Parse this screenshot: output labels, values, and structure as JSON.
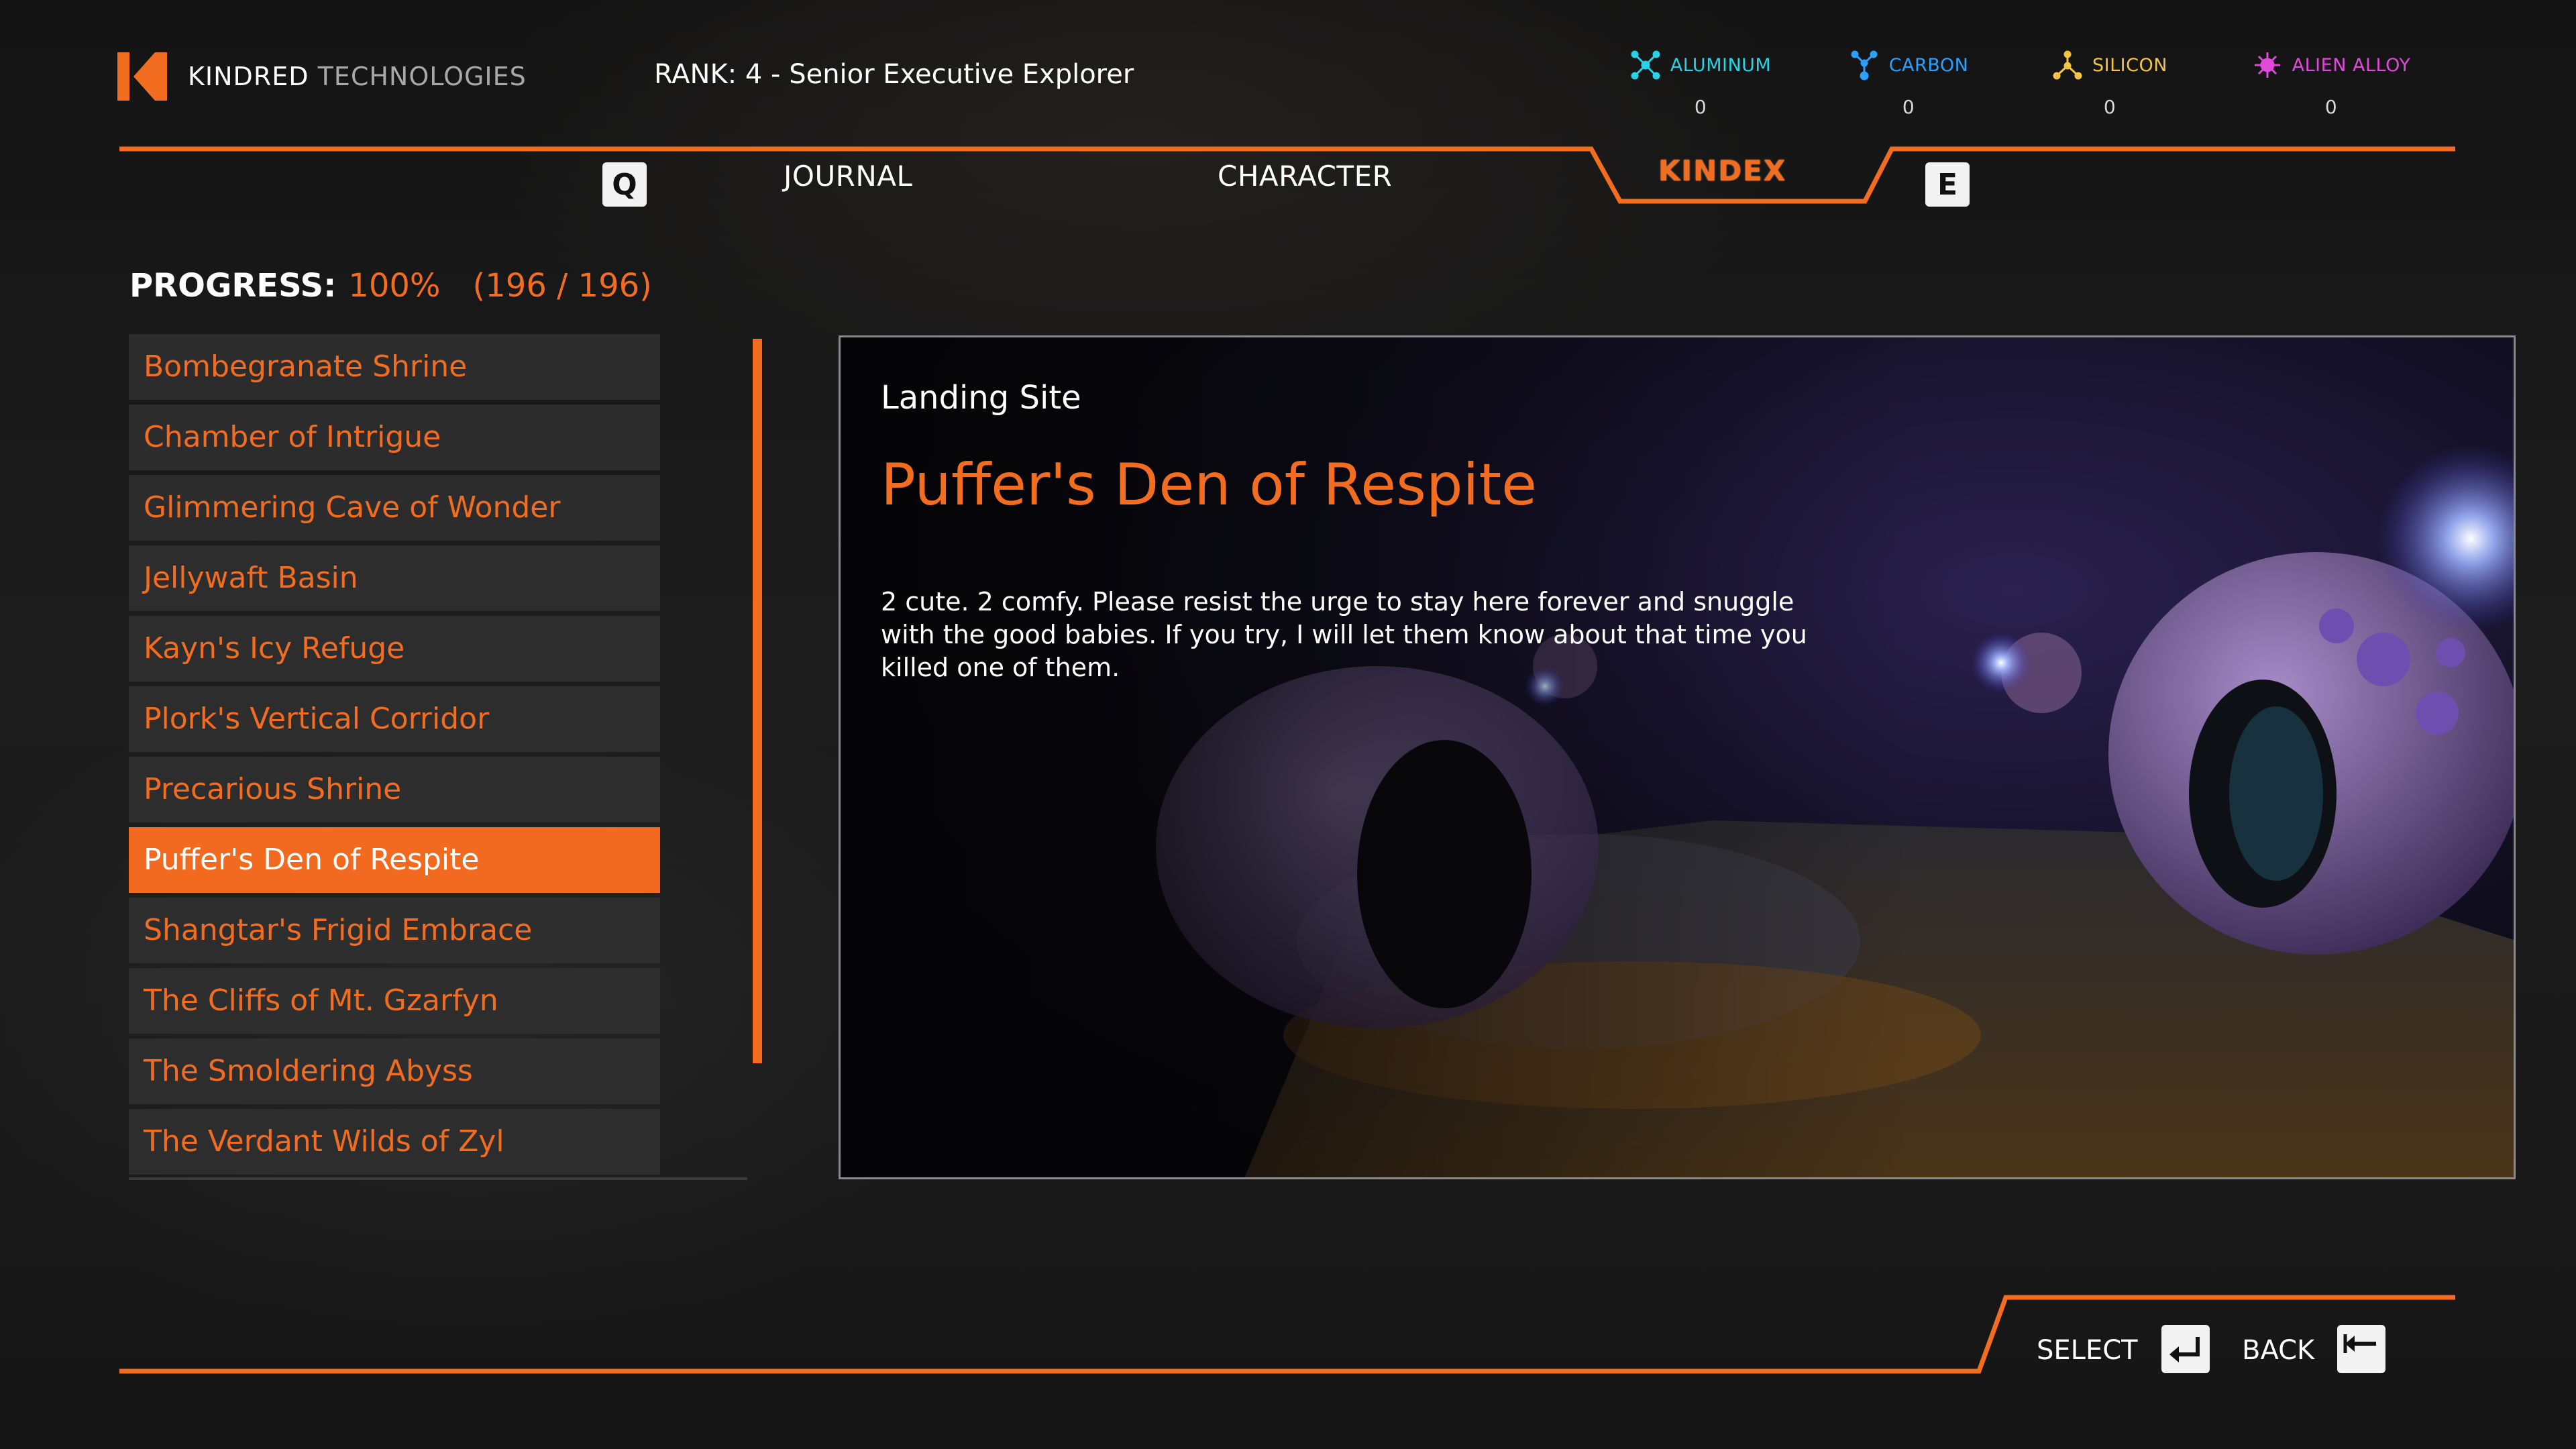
{
  "header": {
    "brand_primary": "KINDRED",
    "brand_secondary": "TECHNOLOGIES",
    "rank_label": "RANK:",
    "rank_value": "4 - Senior Executive Explorer",
    "resources": [
      {
        "label": "ALUMINUM",
        "value": "0",
        "color": "#29d3e6",
        "icon": "aluminum-icon"
      },
      {
        "label": "CARBON",
        "value": "0",
        "color": "#2aa0ff",
        "icon": "carbon-icon"
      },
      {
        "label": "SILICON",
        "value": "0",
        "color": "#f5c542",
        "icon": "silicon-icon"
      },
      {
        "label": "ALIEN ALLOY",
        "value": "0",
        "color": "#e04ad8",
        "icon": "alien-alloy-icon"
      }
    ]
  },
  "tabs": {
    "prev_key": "Q",
    "next_key": "E",
    "items": [
      "JOURNAL",
      "CHARACTER",
      "KINDEX"
    ],
    "active": "KINDEX"
  },
  "progress": {
    "label": "PROGRESS:",
    "percent": "100%",
    "count": "(196 / 196)"
  },
  "list": {
    "items": [
      "Bombegranate Shrine",
      "Chamber of Intrigue",
      "Glimmering Cave of Wonder",
      "Jellywaft Basin",
      "Kayn's Icy Refuge",
      "Plork's Vertical Corridor",
      "Precarious Shrine",
      "Puffer's Den of Respite",
      "Shangtar's Frigid Embrace",
      "The Cliffs of Mt. Gzarfyn",
      "The Smoldering Abyss",
      "The Verdant Wilds of Zyl"
    ],
    "selected": "Puffer's Den of Respite"
  },
  "detail": {
    "category": "Landing Site",
    "title": "Puffer's Den of Respite",
    "description": "2 cute. 2 comfy. Please resist the urge to stay here forever and snuggle with the good babies. If you try, I will let them know about that time you killed one of them."
  },
  "footer": {
    "select_label": "SELECT",
    "back_label": "BACK"
  },
  "colors": {
    "accent": "#f36d21",
    "panel_border": "#8a8a8a",
    "key_bg": "#f2f2f2"
  }
}
